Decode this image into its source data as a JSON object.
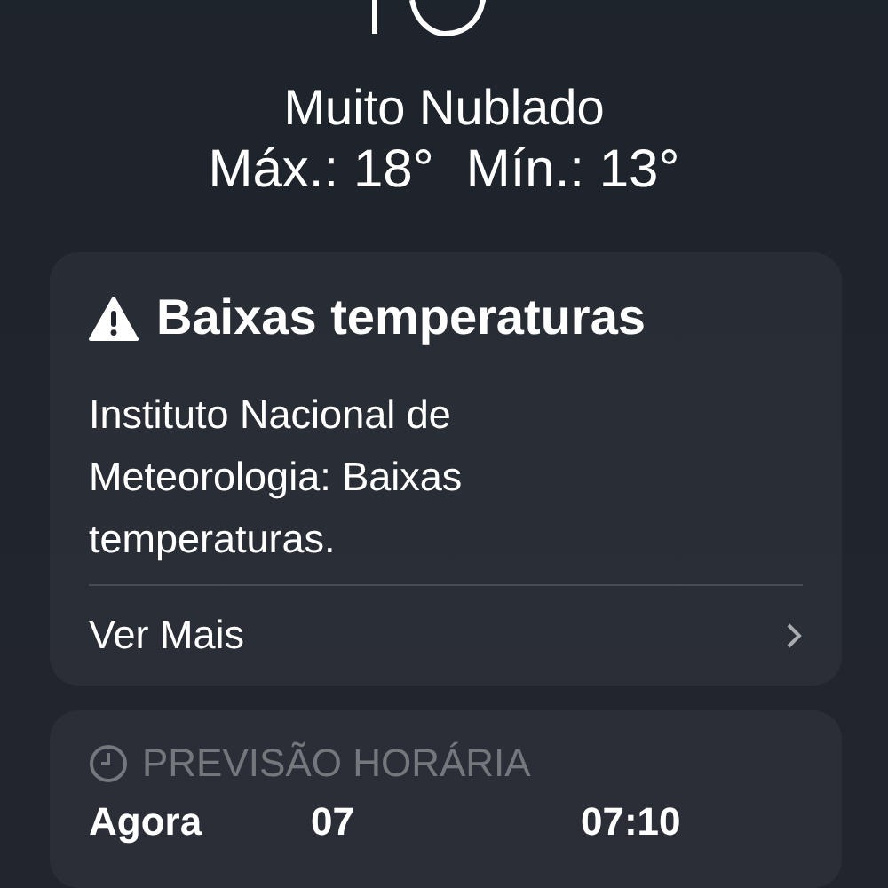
{
  "condition": "Muito Nublado",
  "high_low": [
    {
      "label": "Máx.:",
      "value": "18°"
    },
    {
      "label": "Mín.:",
      "value": "13°"
    }
  ],
  "alert": {
    "title": "Baixas temperaturas",
    "body": "Instituto Nacional de Meteorologia: Baixas temperaturas.",
    "link": "Ver Mais"
  },
  "hourly": {
    "title": "PREVISÃO HORÁRIA",
    "hours": [
      "Agora",
      "07",
      "07:10"
    ]
  }
}
